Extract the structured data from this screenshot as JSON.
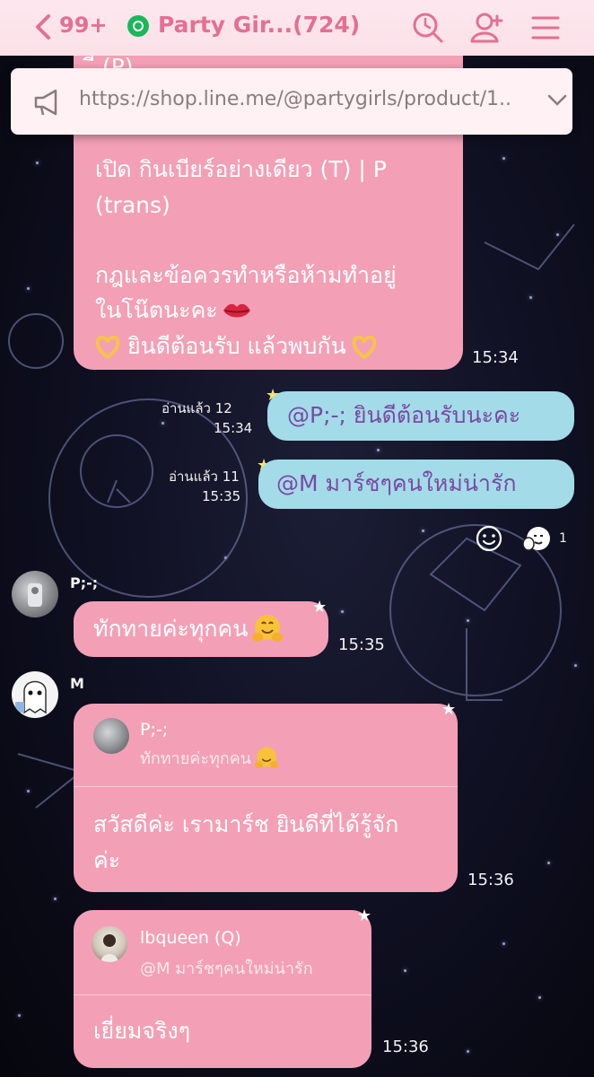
{
  "header": {
    "unread_badge": "99+",
    "room_title": "Party Gir...(724)"
  },
  "announcement": {
    "url": "https://shop.line.me/@partygirls/product/1..."
  },
  "messages": [
    {
      "line0": "ี (P)",
      "line1": "เปิด กินเบียร์อย่างเดียว (T) | P",
      "line2": "(trans)",
      "line3": "กฎและข้อควรทำหรือห้ามทำอยู่",
      "line4": "ในโน๊ตนะคะ",
      "line5": "ยินดีต้อนรับ แล้วพบกัน",
      "time": "15:34"
    },
    {
      "read": "อ่านแล้ว 12",
      "time": "15:34",
      "mention": "@P;-;",
      "text": " ยินดีต้อนรับนะคะ"
    },
    {
      "read": "อ่านแล้ว 11",
      "time": "15:35",
      "mention": "@M",
      "text": " มาร์ชๆคนใหม่น่ารัก"
    },
    {
      "reaction_count": "1"
    },
    {
      "sender": "P;-;",
      "text": "ทักทายค่ะทุกคน",
      "time": "15:35"
    },
    {
      "sender": "M",
      "reply_name": "P;-;",
      "reply_text": "ทักทายค่ะทุกคน",
      "line1": "สวัสดีค่ะ เรามาร์ช ยินดีที่ได้รู้จัก",
      "line2": "ค่ะ",
      "time": "15:36"
    },
    {
      "reply_name": "lbqueen (Q)",
      "reply_text": "@M มาร์ชๆคนใหม่น่ารัก",
      "text": "เยี่ยมจริงๆ",
      "time": "15:36"
    }
  ]
}
